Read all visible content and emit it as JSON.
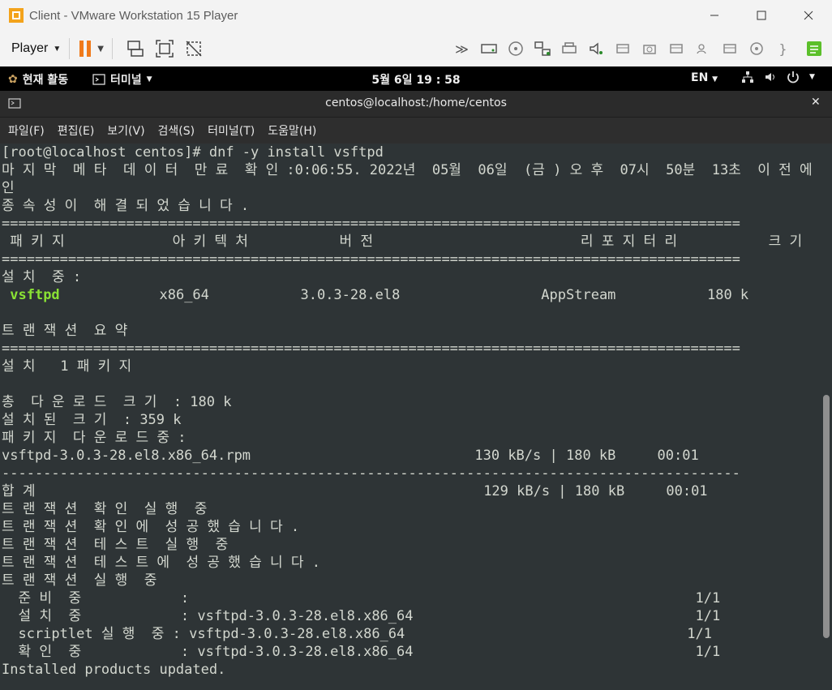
{
  "window": {
    "title": "Client - VMware Workstation 15 Player"
  },
  "toolbar": {
    "player_label": "Player"
  },
  "gnome": {
    "activities": "현재 활동",
    "app_menu": "터미널",
    "clock": "5월 6일  19 : 58",
    "lang": "EN"
  },
  "terminal": {
    "title": "centos@localhost:/home/centos",
    "menu": [
      "파일(F)",
      "편집(E)",
      "보기(V)",
      "검색(S)",
      "터미널(T)",
      "도움말(H)"
    ],
    "lines": [
      "[root@localhost centos]# dnf -y install vsftpd",
      "마 지 막  메 타  데 이 터  만 료  확 인 :0:06:55. 2022년  05월  06일  (금 ) 오 후  07시  50분  13초  이 전 에  확",
      "인",
      "종 속 성 이  해 결 되 었 습 니 다 .",
      "=========================================================================================",
      " 패 키 지             아 키 텍 처           버 전                         리 포 지 터 리           크 기",
      "=========================================================================================",
      "설 치  중 :",
      "",
      "",
      "트 랜 잭 션  요 약",
      "=========================================================================================",
      "설 치   1 패 키 지",
      "",
      "총  다 운 로 드  크 기  : 180 k",
      "설 치 된  크 기  : 359 k",
      "패 키 지  다 운 로 드 중 :",
      "vsftpd-3.0.3-28.el8.x86_64.rpm                           130 kB/s | 180 kB     00:01",
      "-----------------------------------------------------------------------------------------",
      "합 계                                                      129 kB/s | 180 kB     00:01",
      "트 랜 잭 션  확 인  실 행  중",
      "트 랜 잭 션  확 인 에  성 공 했 습 니 다 .",
      "트 랜 잭 션  테 스 트  실 행  중",
      "트 랜 잭 션  테 스 트 에  성 공 했 습 니 다 .",
      "트 랜 잭 션  실 행  중",
      "  준 비  중            :                                                             1/1",
      "  설 치  중            : vsftpd-3.0.3-28.el8.x86_64                                  1/1",
      "  scriptlet 실 행  중 : vsftpd-3.0.3-28.el8.x86_64                                  1/1",
      "  확 인  중            : vsftpd-3.0.3-28.el8.x86_64                                  1/1",
      "Installed products updated."
    ],
    "pkg_row": {
      "name": "vsftpd",
      "rest": "            x86_64           3.0.3-28.el8                 AppStream           180 k"
    }
  }
}
